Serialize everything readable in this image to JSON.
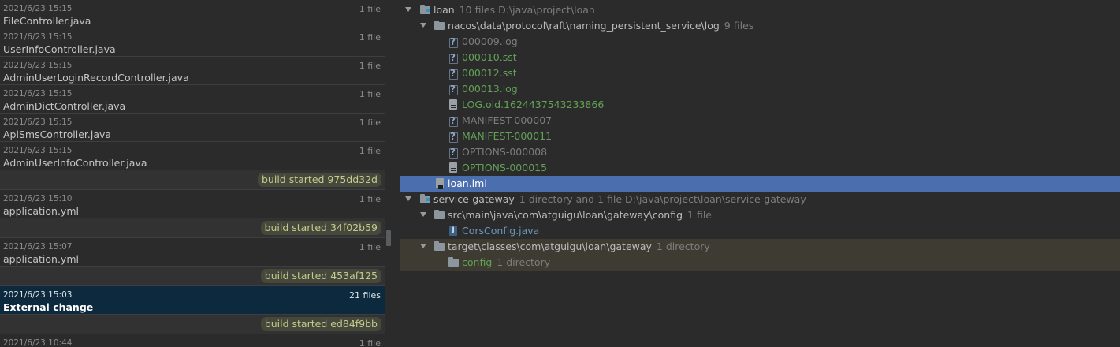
{
  "history": {
    "revisions": [
      {
        "date": "2021/6/23 15:15",
        "count": "1 file",
        "file": "FileController.java"
      },
      {
        "date": "2021/6/23 15:15",
        "count": "1 file",
        "file": "UserInfoController.java"
      },
      {
        "date": "2021/6/23 15:15",
        "count": "1 file",
        "file": "AdminUserLoginRecordController.java"
      },
      {
        "date": "2021/6/23 15:15",
        "count": "1 file",
        "file": "AdminDictController.java"
      },
      {
        "date": "2021/6/23 15:15",
        "count": "1 file",
        "file": "ApiSmsController.java"
      },
      {
        "date": "2021/6/23 15:15",
        "count": "1 file",
        "file": "AdminUserInfoController.java"
      },
      {
        "date": "2021/6/23 15:10",
        "count": "1 file",
        "file": "application.yml"
      },
      {
        "date": "2021/6/23 15:07",
        "count": "1 file",
        "file": "application.yml"
      },
      {
        "date": "2021/6/23 15:03",
        "count": "21 files",
        "file": "External change"
      },
      {
        "date": "2021/6/23 10:44",
        "count": "1 file",
        "file": ""
      }
    ],
    "labels": [
      "build started 975dd32d",
      "build started 34f02b59",
      "build started 453af125",
      "build started ed84f9bb"
    ]
  },
  "tree": {
    "root": {
      "name": "loan",
      "meta": "10 files  D:\\java\\project\\loan"
    },
    "log_dir": {
      "name": "nacos\\data\\protocol\\raft\\naming_persistent_service\\log",
      "meta": "9 files"
    },
    "log_files": [
      "000009.log",
      "000010.sst",
      "000012.sst",
      "000013.log",
      "LOG.old.1624437543233866",
      "MANIFEST-000007",
      "MANIFEST-000011",
      "OPTIONS-000008",
      "OPTIONS-000015"
    ],
    "iml": "loan.iml",
    "gateway": {
      "name": "service-gateway",
      "meta": "1 directory and 1 file  D:\\java\\project\\loan\\service-gateway"
    },
    "config_dir": {
      "name": "src\\main\\java\\com\\atguigu\\loan\\gateway\\config",
      "meta": "1 file"
    },
    "cors": "CorsConfig.java",
    "target_dir": {
      "name": "target\\classes\\com\\atguigu\\loan\\gateway",
      "meta": "1 directory"
    },
    "config": {
      "name": "config",
      "meta": "1 directory"
    }
  }
}
